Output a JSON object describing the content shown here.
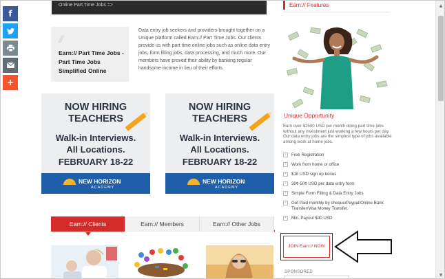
{
  "share_bar": {
    "items": [
      {
        "icon": "facebook-icon",
        "glyph": "f",
        "color": "#3b5998"
      },
      {
        "icon": "twitter-icon",
        "glyph": "t",
        "color": "#1da1f2"
      },
      {
        "icon": "print-icon",
        "glyph": "⎙",
        "color": "#7b8a8f"
      },
      {
        "icon": "email-icon",
        "glyph": "✉",
        "color": "#5f6d74"
      },
      {
        "icon": "more-plus-icon",
        "glyph": "+",
        "color": "#f4542c"
      }
    ]
  },
  "hero": {
    "caption": "Online Part Time Jobs =>"
  },
  "about": {
    "quote_mark": "//",
    "card_title": "Earn:// Part Time Jobs - Part Time Jobs Simplified Online",
    "text": "Data entry job seekers and providers brought together on a Unique platform called Earn:// Part Time Jobs. Our clients provide us with part time online jobs such as online data entry jobs, form filling jobs, data processing, and much more. Our members have proved their ability by banking regular handsome income in lieu of their efforts."
  },
  "ads": [
    {
      "headline_1": "NOW HIRING",
      "headline_2": "TEACHERS",
      "line_3": "Walk-in Interviews.",
      "line_4": "All Locations.",
      "line_5": "FEBRUARY 18-22",
      "brand": "NEW HORIZON",
      "brand_sub": "ACADEMY"
    },
    {
      "headline_1": "NOW HIRING",
      "headline_2": "TEACHERS",
      "line_3": "Walk-in Interviews.",
      "line_4": "All Locations.",
      "line_5": "FEBRUARY 18-22",
      "brand": "NEW HORIZON",
      "brand_sub": "ACADEMY"
    }
  ],
  "tabs": [
    {
      "label": "Earn:// Clients",
      "active": true
    },
    {
      "label": "Earn:// Members",
      "active": false
    },
    {
      "label": "Earn:// Other Jobs",
      "active": false
    }
  ],
  "sidebar": {
    "section_title": "Earn:// Features",
    "subtitle": "Unique Opportunity",
    "paragraph": "Earn over $2500 USD per month doing part time jobs without any investment just working a few hours per day. Our data entry jobs are the simplest type of jobs available among work at home jobs.",
    "features": [
      "Free Registration",
      "Work from home or office",
      "$10 USD sign up bonus",
      "30¢-50¢ USD per data entry form",
      "Simple Form Filling & Data Entry Jobs",
      "Get Paid monthly by cheque/Paypal/Online Bank Transfer/Visa Money Transfer.",
      "Min. Payout $40 USD"
    ],
    "join_button": "JOIN Earn:// NOW",
    "sponsored": "SPONSORED"
  },
  "colors": {
    "accent": "#d62b2b",
    "ad_blue": "#1f5faa",
    "ad_pencil": "#f3a41a"
  }
}
